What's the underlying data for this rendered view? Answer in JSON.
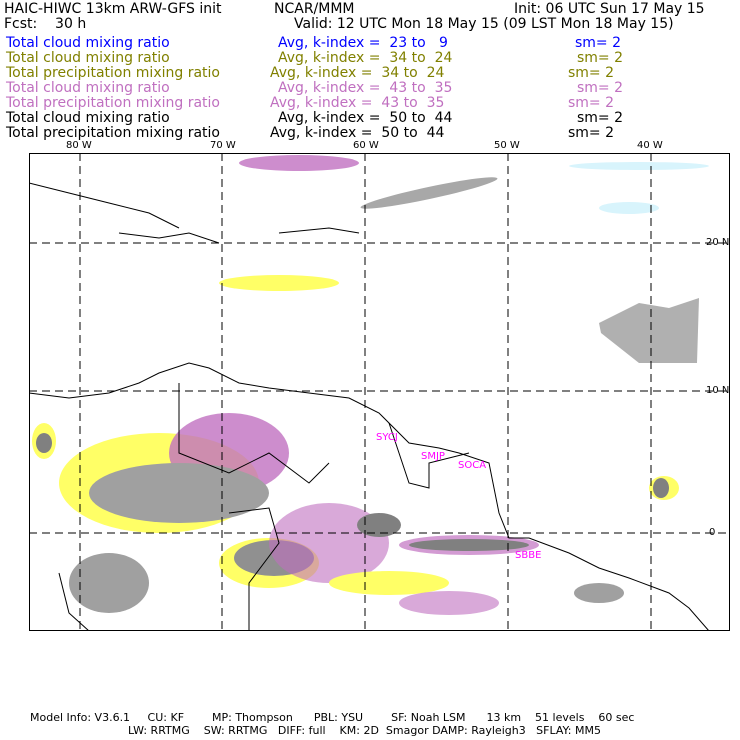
{
  "header": {
    "title": "HAIC-HIWC 13km ARW-GFS init",
    "org": "NCAR/MMM",
    "init": "Init: 06 UTC Sun 17 May 15",
    "fcst": "Fcst:    30 h",
    "valid": "Valid: 12 UTC Mon 18 May 15 (09 LST Mon 18 May 15)"
  },
  "fields": [
    {
      "name": "Total cloud mixing ratio",
      "avg": "Avg, k-index =  23 to   9",
      "sm": "sm= 2",
      "color": "#0000ff"
    },
    {
      "name": "Total cloud mixing ratio",
      "avg": "Avg, k-index =  34 to  24",
      "sm": "sm= 2",
      "color": "#808000"
    },
    {
      "name": "Total precipitation mixing ratio",
      "avg": "Avg, k-index =  34 to  24",
      "sm": "sm= 2",
      "color": "#808000"
    },
    {
      "name": "Total cloud mixing ratio",
      "avg": "Avg, k-index =  43 to  35",
      "sm": "sm= 2",
      "color": "#c070c0"
    },
    {
      "name": "Total precipitation mixing ratio",
      "avg": "Avg, k-index =  43 to  35",
      "sm": "sm= 2",
      "color": "#c070c0"
    },
    {
      "name": "Total cloud mixing ratio",
      "avg": "Avg, k-index =  50 to  44",
      "sm": "sm= 2",
      "color": "#000000"
    },
    {
      "name": "Total precipitation mixing ratio",
      "avg": "Avg, k-index =  50 to  44",
      "sm": "sm= 2",
      "color": "#000000"
    }
  ],
  "axes": {
    "lon": [
      "80 W",
      "70 W",
      "60 W",
      "50 W",
      "40 W"
    ],
    "lat": [
      "20 N",
      "10 N",
      "0"
    ]
  },
  "stations": [
    "SYCJ",
    "SMJP",
    "SOCA",
    "SBBE"
  ],
  "footer": {
    "line1": "Model Info: V3.6.1     CU: KF        MP: Thompson      PBL: YSU        SF: Noah LSM      13 km    51 levels    60 sec",
    "line2": "LW: RRTMG    SW: RRTMG   DIFF: full    KM: 2D  Smagor DAMP: Rayleigh3   SFLAY: MM5"
  }
}
